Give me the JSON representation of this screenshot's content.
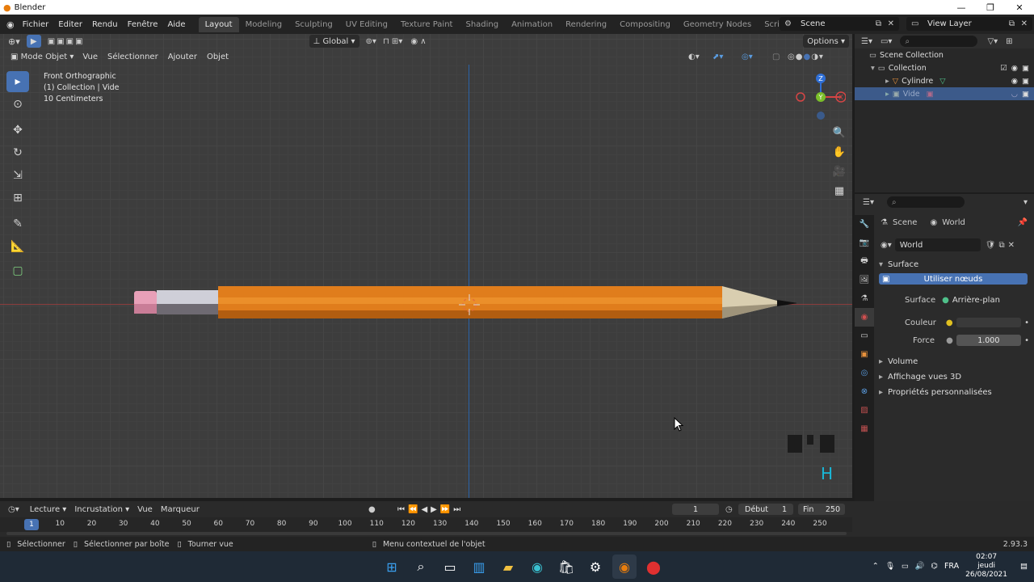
{
  "window": {
    "title": "Blender",
    "minimize": "—",
    "maximize": "❐",
    "close": "✕"
  },
  "menu": [
    "Fichier",
    "Editer",
    "Rendu",
    "Fenêtre",
    "Aide"
  ],
  "workspaces": [
    "Layout",
    "Modeling",
    "Sculpting",
    "UV Editing",
    "Texture Paint",
    "Shading",
    "Animation",
    "Rendering",
    "Compositing",
    "Geometry Nodes",
    "Scripting"
  ],
  "scene": {
    "name": "Scene"
  },
  "view_layer": {
    "name": "View Layer"
  },
  "viewport": {
    "mode": "Mode Objet",
    "menus": [
      "Vue",
      "Sélectionner",
      "Ajouter",
      "Objet"
    ],
    "orientation": "Global",
    "options": "Options",
    "view_name": "Front Orthographic",
    "collection_info": "(1) Collection | Vide",
    "scale_info": "10 Centimeters",
    "gizmo": {
      "z": "Z",
      "y": "Y",
      "x": "X"
    },
    "key_overlay": "H"
  },
  "outliner": {
    "rows": [
      {
        "label": "Scene Collection"
      },
      {
        "label": "Collection"
      },
      {
        "label": "Cylindre"
      },
      {
        "label": "Vide"
      }
    ]
  },
  "properties": {
    "breadcrumb_scene": "Scene",
    "breadcrumb_world": "World",
    "world_name": "World",
    "surface_header": "Surface",
    "use_nodes": "Utiliser nœuds",
    "surface_label": "Surface",
    "surface_value": "Arrière-plan",
    "color_label": "Couleur",
    "force_label": "Force",
    "force_value": "1.000",
    "sections": [
      "Volume",
      "Affichage vues 3D",
      "Propriétés personnalisées"
    ]
  },
  "timeline": {
    "menus": [
      "Lecture",
      "Incrustation",
      "Vue",
      "Marqueur"
    ],
    "current_frame": "1",
    "start_label": "Début",
    "start_value": "1",
    "end_label": "Fin",
    "end_value": "250",
    "ruler_current": "1",
    "ruler_ticks": [
      "10",
      "20",
      "30",
      "40",
      "50",
      "60",
      "70",
      "80",
      "90",
      "100",
      "110",
      "120",
      "130",
      "140",
      "150",
      "160",
      "170",
      "180",
      "190",
      "200",
      "210",
      "220",
      "230",
      "240",
      "250"
    ]
  },
  "status": {
    "select": "Sélectionner",
    "box_select": "Sélectionner par boîte",
    "rotate_view": "Tourner vue",
    "context_menu": "Menu contextuel de l'objet",
    "version": "2.93.3"
  },
  "taskbar": {
    "language": "FRA",
    "time": "02:07",
    "day": "jeudi",
    "date": "26/08/2021"
  },
  "colors": {
    "accent": "#4772b3",
    "pencil_body": "#e07d1c",
    "eraser": "#e8a0b8",
    "axis_x": "#8c3d3d",
    "axis_z": "#2a63a8"
  }
}
